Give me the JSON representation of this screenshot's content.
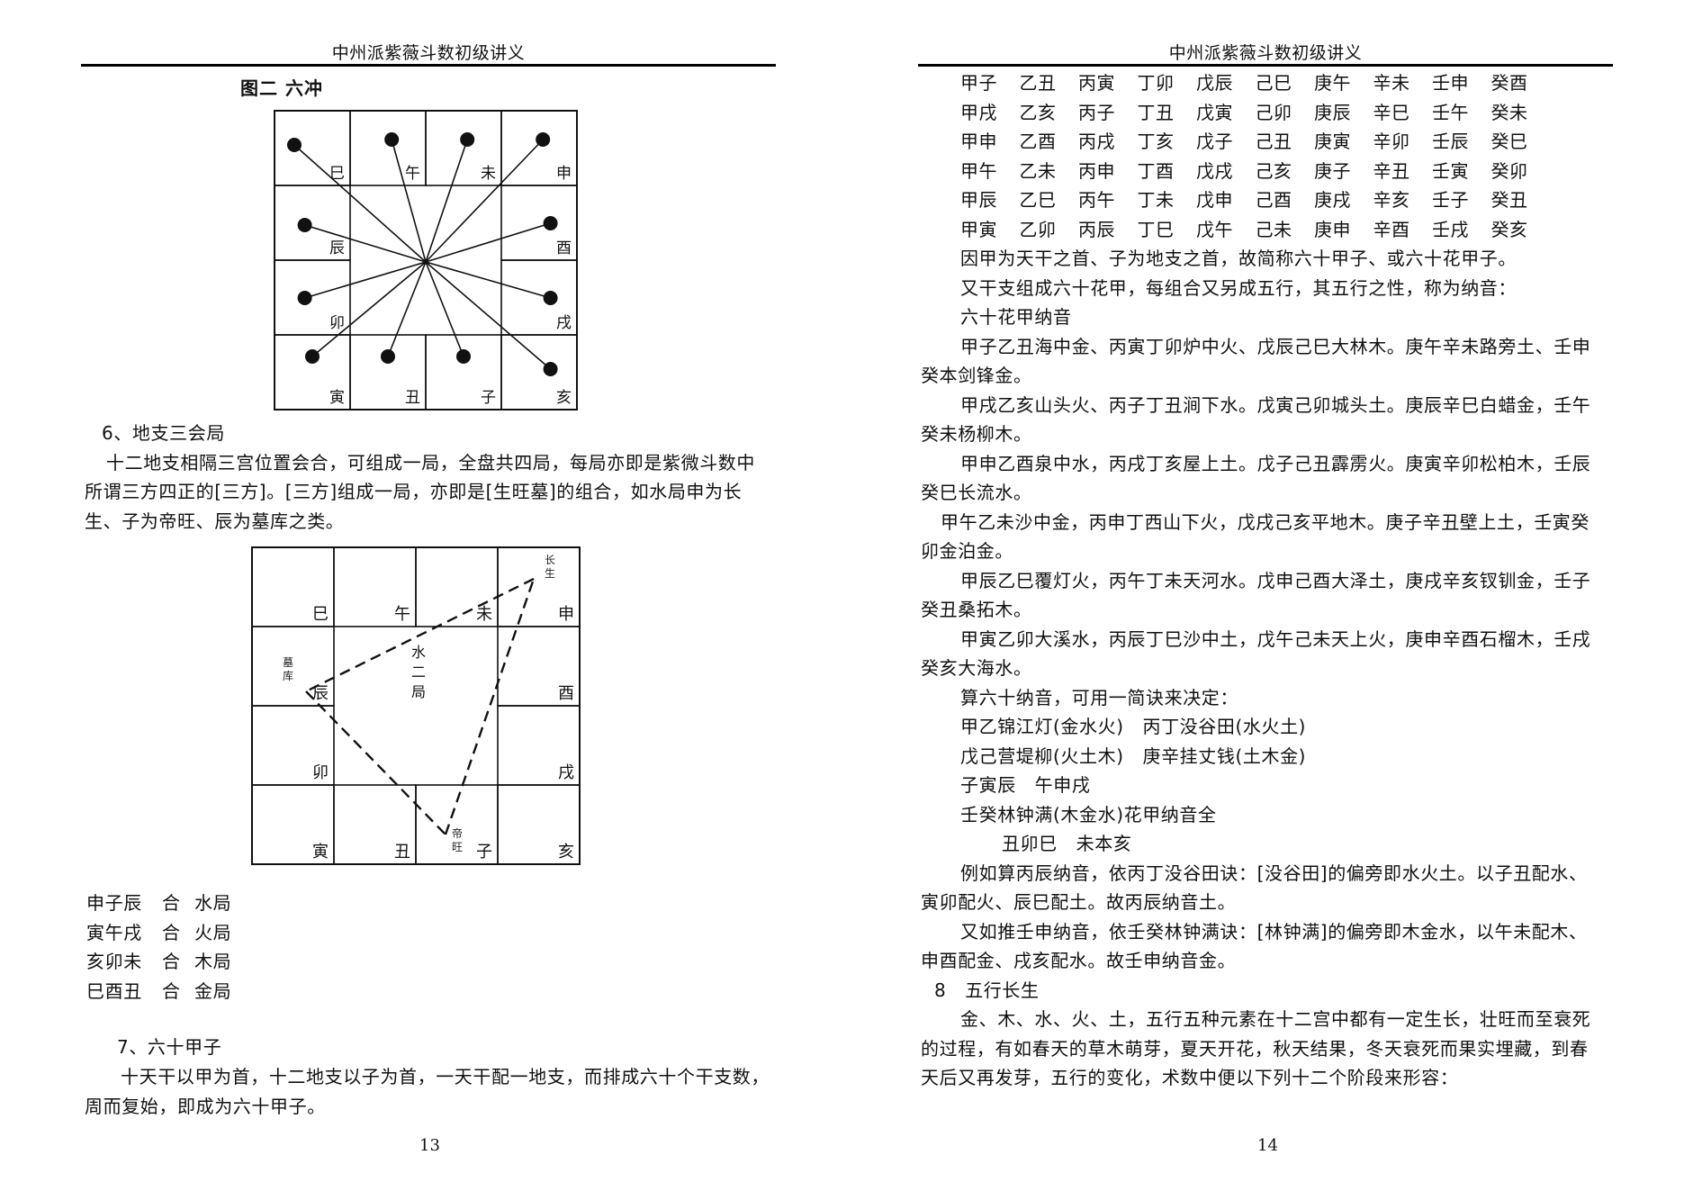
{
  "document": {
    "running_head": "中州派紫薇斗数初级讲义"
  },
  "left_page": {
    "page_number": "13",
    "figure2": {
      "title": "图二  六冲",
      "branches_clockwise_from_top_left": [
        "巳",
        "午",
        "未",
        "申",
        "酉",
        "戌",
        "亥",
        "子",
        "丑",
        "寅",
        "卯",
        "辰"
      ],
      "opposition_pairs": [
        [
          "巳",
          "亥"
        ],
        [
          "午",
          "子"
        ],
        [
          "未",
          "丑"
        ],
        [
          "申",
          "寅"
        ],
        [
          "酉",
          "卯"
        ],
        [
          "戌",
          "辰"
        ]
      ]
    },
    "section6": {
      "heading": "6、地支三会局",
      "para_lines": [
        "十二地支相隔三宫位置会合，可组成一局，全盘共四局，每局亦即是紫微斗数中",
        "所谓三方四正的[三方]。[三方]组成一局，亦即是[生旺墓]的组合，如水局申为长",
        "生、子为帝旺、辰为墓库之类。"
      ]
    },
    "figure3": {
      "center_label": [
        "水",
        "二",
        "局"
      ],
      "branches_clockwise_from_top_left": [
        "巳",
        "午",
        "未",
        "申",
        "酉",
        "戌",
        "亥",
        "子",
        "丑",
        "寅",
        "卯",
        "辰"
      ],
      "annotations": {
        "shen": "长生",
        "zi": "帝旺",
        "chen": "墓库"
      }
    },
    "combinations": [
      {
        "branches": "申子辰",
        "he": "合",
        "result": "水局"
      },
      {
        "branches": "寅午戌",
        "he": "合",
        "result": "火局"
      },
      {
        "branches": "亥卯未",
        "he": "合",
        "result": "木局"
      },
      {
        "branches": "巳酉丑",
        "he": "合",
        "result": "金局"
      }
    ],
    "section7": {
      "heading": "7、六十甲子",
      "para_lines": [
        "十天干以甲为首，十二地支以子为首，一天干配一地支，而排成六十个干支数，",
        "周而复始，即成为六十甲子。"
      ]
    }
  },
  "right_page": {
    "page_number": "14",
    "sixty_jiazi_table": [
      [
        "甲子",
        "乙丑",
        "丙寅",
        "丁卯",
        "戊辰",
        "己巳",
        "庚午",
        "辛未",
        "壬申",
        "癸酉"
      ],
      [
        "甲戌",
        "乙亥",
        "丙子",
        "丁丑",
        "戊寅",
        "己卯",
        "庚辰",
        "辛巳",
        "壬午",
        "癸未"
      ],
      [
        "甲申",
        "乙酉",
        "丙戌",
        "丁亥",
        "戊子",
        "己丑",
        "庚寅",
        "辛卯",
        "壬辰",
        "癸巳"
      ],
      [
        "甲午",
        "乙未",
        "丙申",
        "丁酉",
        "戊戌",
        "己亥",
        "庚子",
        "辛丑",
        "壬寅",
        "癸卯"
      ],
      [
        "甲辰",
        "乙巳",
        "丙午",
        "丁未",
        "戊申",
        "己酉",
        "庚戌",
        "辛亥",
        "壬子",
        "癸丑"
      ],
      [
        "甲寅",
        "乙卯",
        "丙辰",
        "丁巳",
        "戊午",
        "己未",
        "庚申",
        "辛酉",
        "壬戌",
        "癸亥"
      ]
    ],
    "lines": [
      {
        "indent": 1,
        "text": "因甲为天干之首、子为地支之首，故简称六十甲子、或六十花甲子。"
      },
      {
        "indent": 1,
        "text": "又干支组成六十花甲，每组合又另成五行，其五行之性，称为纳音："
      },
      {
        "indent": 1,
        "text": "六十花甲纳音"
      },
      {
        "indent": 1,
        "text": "甲子乙丑海中金、丙寅丁卯炉中火、戊辰己巳大林木。庚午辛未路旁土、壬申"
      },
      {
        "indent": 0,
        "text": "癸本剑锋金。"
      },
      {
        "indent": 1,
        "text": "甲戌乙亥山头火、丙子丁丑涧下水。戊寅己卯城头土。庚辰辛巳白蜡金，壬午"
      },
      {
        "indent": 0,
        "text": "癸未杨柳木。"
      },
      {
        "indent": 1,
        "text": "甲申乙酉泉中水，丙戌丁亥屋上土。戊子己丑霹雳火。庚寅辛卯松柏木，壬辰"
      },
      {
        "indent": 0,
        "text": "癸巳长流水。"
      },
      {
        "indent": 2,
        "text": "甲午乙未沙中金，丙申丁西山下火，戊戌己亥平地木。庚子辛丑壁上土，壬寅癸"
      },
      {
        "indent": 0,
        "text": "卯金泊金。"
      },
      {
        "indent": 1,
        "text": "甲辰乙巳覆灯火，丙午丁未天河水。戊申己酉大泽土，庚戌辛亥钗钏金，壬子"
      },
      {
        "indent": 0,
        "text": "癸丑桑拓木。"
      },
      {
        "indent": 1,
        "text": "甲寅乙卯大溪水，丙辰丁巳沙中土，戊午己未天上火，庚申辛酉石榴木，壬戌"
      },
      {
        "indent": 0,
        "text": "癸亥大海水。"
      },
      {
        "indent": 1,
        "text": "算六十纳音，可用一简诀来决定："
      },
      {
        "indent": 1,
        "text": "甲乙锦江灯(金水火)   丙丁没谷田(水火土)"
      },
      {
        "indent": 1,
        "text": "戊己营堤柳(火土木)   庚辛挂丈钱(土木金)"
      },
      {
        "indent": 1,
        "text": "子寅辰   午申戌"
      },
      {
        "indent": 1,
        "text": "壬癸林钟满(木金水)花甲纳音全"
      },
      {
        "indent": 3,
        "text": "丑卯巳   未本亥"
      },
      {
        "indent": 1,
        "text": "例如算丙辰纳音，依丙丁没谷田诀：[没谷田]的偏旁即水火土。以子丑配水、"
      },
      {
        "indent": 0,
        "text": "寅卯配火、辰巳配土。故丙辰纳音土。"
      },
      {
        "indent": 1,
        "text": "又如推壬申纳音，依壬癸林钟满诀：[林钟满]的偏旁即木金水，以午未配木、"
      },
      {
        "indent": 0,
        "text": "申酉配金、戌亥配水。故壬申纳音金。"
      },
      {
        "indent": 4,
        "text": "8   五行长生"
      },
      {
        "indent": 1,
        "text": "金、木、水、火、土，五行五种元素在十二宫中都有一定生长，壮旺而至衰死"
      },
      {
        "indent": 0,
        "text": "的过程，有如春天的草木萌芽，夏天开花，秋天结果，冬天衰死而果实埋藏，到春"
      },
      {
        "indent": 0,
        "text": "天后又再发芽，五行的变化，术数中便以下列十二个阶段来形容："
      }
    ]
  }
}
